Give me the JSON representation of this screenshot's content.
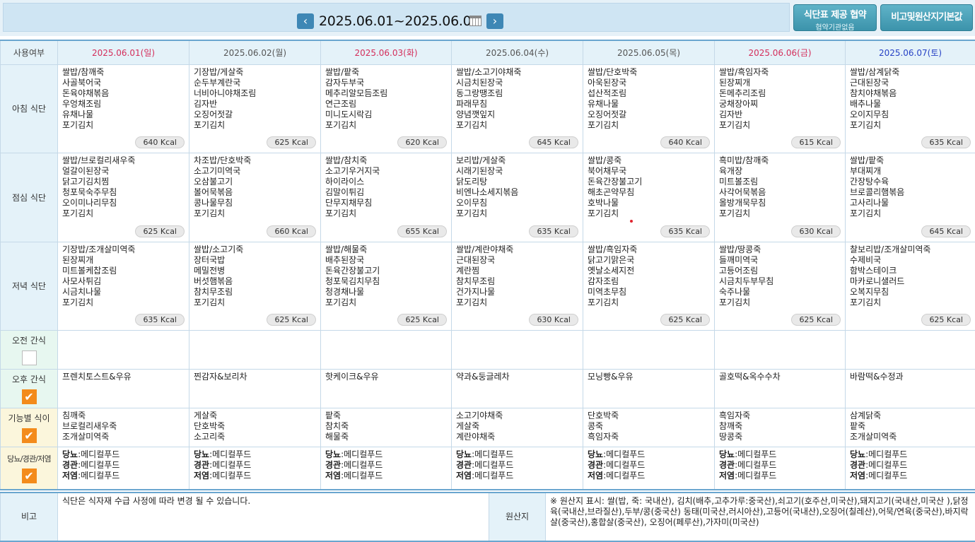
{
  "header": {
    "date_range": "2025.06.01~2025.06.07",
    "contract_button": "식단표 제공 협약",
    "contract_sub": "협약기관없음",
    "origin_button": "비고및원산지기본값"
  },
  "table": {
    "use_label": "사용여부",
    "days": [
      {
        "label": "2025.06.01(일)",
        "color": "#d42e5b"
      },
      {
        "label": "2025.06.02(월)",
        "color": "#555555"
      },
      {
        "label": "2025.06.03(화)",
        "color": "#d42e5b"
      },
      {
        "label": "2025.06.04(수)",
        "color": "#555555"
      },
      {
        "label": "2025.06.05(목)",
        "color": "#555555"
      },
      {
        "label": "2025.06.06(금)",
        "color": "#d42e5b"
      },
      {
        "label": "2025.06.07(토)",
        "color": "#2742c5"
      }
    ],
    "rows": {
      "breakfast": {
        "label": "아침 식단",
        "cells": [
          {
            "items": [
              "쌀밥/참깨죽",
              "사골북어국",
              "돈육야채볶음",
              "우엉채조림",
              "유채나물",
              "포기김치"
            ],
            "kcal": "640 Kcal"
          },
          {
            "items": [
              "기장밥/게살죽",
              "순두부계란국",
              "너비아니야채조림",
              "김자반",
              "오징어젓갈",
              "포기김치"
            ],
            "kcal": "625 Kcal"
          },
          {
            "items": [
              "쌀밥/팥죽",
              "감자두부국",
              "메추리알모듬조림",
              "연근조림",
              "미니도시락김",
              "포기김치"
            ],
            "kcal": "620 Kcal"
          },
          {
            "items": [
              "쌀밥/소고기야채죽",
              "시금치된장국",
              "동그랑땡조림",
              "파래무침",
              "양념깻잎지",
              "포기김치"
            ],
            "kcal": "645 Kcal"
          },
          {
            "items": [
              "쌀밥/단호박죽",
              "아욱된장국",
              "섭산적조림",
              "유채나물",
              "오징어젓갈",
              "포기김치"
            ],
            "kcal": "640 Kcal"
          },
          {
            "items": [
              "쌀밥/흑임자죽",
              "된장찌개",
              "돈메추리조림",
              "궁채장아찌",
              "김자반",
              "포기김치"
            ],
            "kcal": "615 Kcal"
          },
          {
            "items": [
              "쌀밥/삼계닭죽",
              "근대된장국",
              "참치야채볶음",
              "배추나물",
              "오이지무침",
              "포기김치"
            ],
            "kcal": "635 Kcal"
          }
        ]
      },
      "lunch": {
        "label": "점심 식단",
        "cells": [
          {
            "items": [
              "쌀밥/브로컬리새우죽",
              "얼갈이된장국",
              "닭고기김치찜",
              "청포묵숙주무침",
              "오이미나리무침",
              "포기김치"
            ],
            "kcal": "625 Kcal"
          },
          {
            "items": [
              "차조밥/단호박죽",
              "소고기미역국",
              "오삼불고기",
              "볼어묵볶음",
              "콩나물무침",
              "포기김치"
            ],
            "kcal": "660 Kcal"
          },
          {
            "items": [
              "쌀밥/참치죽",
              "소고기우거지국",
              "하이라이스",
              "김말이튀김",
              "단무지채무침",
              "포기김치"
            ],
            "kcal": "655 Kcal"
          },
          {
            "items": [
              "보리밥/게살죽",
              "시래기된장국",
              "닭도리탕",
              "비엔나소세지볶음",
              "오이무침",
              "포기김치"
            ],
            "kcal": "635 Kcal"
          },
          {
            "items": [
              "쌀밥/콩죽",
              "북어채무국",
              "돈육간장불고기",
              "해초곤약무침",
              "호박나물",
              "포기김치"
            ],
            "kcal": "635 Kcal"
          },
          {
            "items": [
              "흑미밥/참깨죽",
              "육개장",
              "미트볼조림",
              "사각어묵볶음",
              "올방개묵무침",
              "포기김치"
            ],
            "kcal": "630 Kcal"
          },
          {
            "items": [
              "쌀밥/팥죽",
              "부대찌개",
              "간장탕수육",
              "브로콜리햄볶음",
              "고사리나물",
              "포기김치"
            ],
            "kcal": "645 Kcal"
          }
        ]
      },
      "dinner": {
        "label": "저녁 식단",
        "cells": [
          {
            "items": [
              "기장밥/조개살미역죽",
              "된장찌개",
              "미트볼케찹조림",
              "사모사튀김",
              "시금치나물",
              "포기김치"
            ],
            "kcal": "635 Kcal"
          },
          {
            "items": [
              "쌀밥/소고기죽",
              "장터국밥",
              "메밀전병",
              "버섯햄볶음",
              "참치무조림",
              "포기김치"
            ],
            "kcal": "625 Kcal"
          },
          {
            "items": [
              "쌀밥/해물죽",
              "배추된장국",
              "돈육간장불고기",
              "청포묵김치무침",
              "청경채나물",
              "포기김치"
            ],
            "kcal": "625 Kcal"
          },
          {
            "items": [
              "쌀밥/계란야채죽",
              "근대된장국",
              "계란찜",
              "참치무조림",
              "건가지나물",
              "포기김치"
            ],
            "kcal": "630 Kcal"
          },
          {
            "items": [
              "쌀밥/흑임자죽",
              "닭고기맑은국",
              "옛날소세지전",
              "감자조림",
              "미역초무침",
              "포기김치"
            ],
            "kcal": "625 Kcal"
          },
          {
            "items": [
              "쌀밥/땅콩죽",
              "들깨미역국",
              "고등어조림",
              "시금치두부무침",
              "숙주나물",
              "포기김치"
            ],
            "kcal": "625 Kcal"
          },
          {
            "items": [
              "찰보리밥/조개살미역죽",
              "수제비국",
              "함박스테이크",
              "마카로니샐러드",
              "오복지무침",
              "포기김치"
            ],
            "kcal": "625 Kcal"
          }
        ]
      },
      "am_snack": {
        "label": "오전 간식",
        "checked": false,
        "cells": [
          "",
          "",
          "",
          "",
          "",
          "",
          ""
        ]
      },
      "pm_snack": {
        "label": "오후 간식",
        "checked": true,
        "cells": [
          "프렌치토스트&우유",
          "찐감자&보리차",
          "핫케이크&우유",
          "약과&둥글레차",
          "모닝빵&우유",
          "골호떡&옥수수차",
          "바람떡&수정과"
        ]
      },
      "functional": {
        "label": "기능별 식이",
        "checked": true,
        "cells": [
          [
            "침깨죽",
            "브로컬리새우죽",
            "조개살미역죽"
          ],
          [
            "게살죽",
            "단호박죽",
            "소고리죽"
          ],
          [
            "팥죽",
            "참치죽",
            "해물죽"
          ],
          [
            "소고기야채죽",
            "게살죽",
            "계란야채죽"
          ],
          [
            "단호박죽",
            "콩죽",
            "흑임자죽"
          ],
          [
            "흑임자죽",
            "참깨죽",
            "땅콩죽"
          ],
          [
            "삼계닭죽",
            "팥죽",
            "조개살미역죽"
          ]
        ]
      },
      "diabetes": {
        "label": "당뇨/경관/저염",
        "checked": true,
        "line1_key": "당뇨",
        "line2_key": "경관",
        "line3_key": "저염",
        "value": ":메디컬푸드"
      }
    }
  },
  "notes": {
    "remark_label": "비고",
    "remark_text": "식단은 식자재 수급 사정에 따라 변경 될 수 있습니다.",
    "origin_label": "원산지",
    "origin_text": "※ 원산지 표시: 쌀(밥, 죽: 국내산), 김치(배추,고추가루:중국산),쇠고기(호주산,미국산),돼지고기(국내산,미국산 ),닭정육(국내산,브라질산),두부/콩(중국산) 동태(미국산,러시아산),고등어(국내산),오징어(칠레산),어묵/연육(중국산),바지락살(중국산),홍합살(중국산), 오징어(페루산),가자미(미국산)"
  }
}
